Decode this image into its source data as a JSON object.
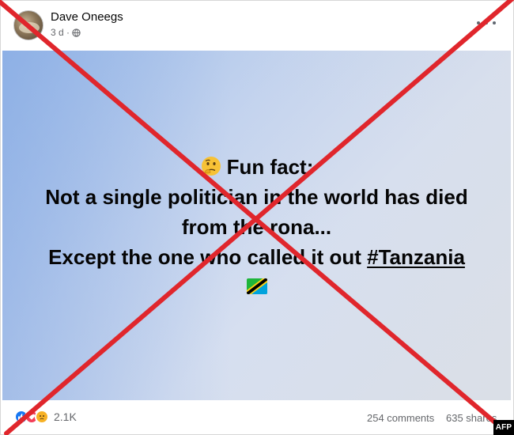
{
  "post": {
    "author": "Dave Oneegs",
    "time": "3 d ·",
    "privacy_icon": "globe-icon",
    "more_icon": "more-options-icon"
  },
  "image_text": {
    "line1": "Fun fact:",
    "line2": "Not a single politician in the world has died",
    "line3": "from the rona...",
    "line4_prefix": "Except the one who called it out ",
    "hashtag": "#Tanzania",
    "emoji_top": "thinking-face-icon",
    "emoji_bottom": "tanzania-flag-icon"
  },
  "footer": {
    "reaction_icons": [
      "like-icon",
      "love-icon",
      "sad-icon"
    ],
    "reaction_count": "2.1K",
    "comments": "254 comments",
    "shares": "635 shares"
  },
  "overlay": {
    "cross_color": "#e0262c",
    "badge": "AFP"
  }
}
